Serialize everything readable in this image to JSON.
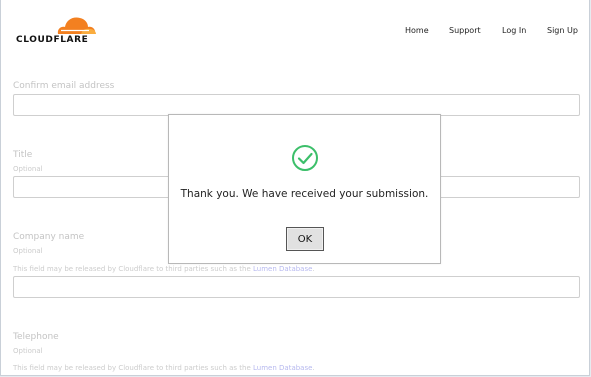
{
  "brand": {
    "logo_text": "CLOUDFLARE",
    "logo_color": "#f38020"
  },
  "nav": {
    "home": "Home",
    "support": "Support",
    "login": "Log In",
    "signup": "Sign Up"
  },
  "form": {
    "confirm_email_label": "Confirm email address",
    "title_label": "Title",
    "title_optional": "Optional",
    "company_label": "Company name",
    "company_optional": "Optional",
    "company_note_prefix": "This field may be released by Cloudflare to third parties such as the ",
    "company_note_link": "Lumen Database",
    "company_note_suffix": ".",
    "telephone_label": "Telephone",
    "telephone_optional": "Optional",
    "telephone_note_prefix": "This field may be released by Cloudflare to third parties such as the ",
    "telephone_note_link": "Lumen Database",
    "telephone_note_suffix": "."
  },
  "modal": {
    "message": "Thank you. We have received your submission.",
    "ok_label": "OK",
    "success_color": "#3cbf6a"
  }
}
